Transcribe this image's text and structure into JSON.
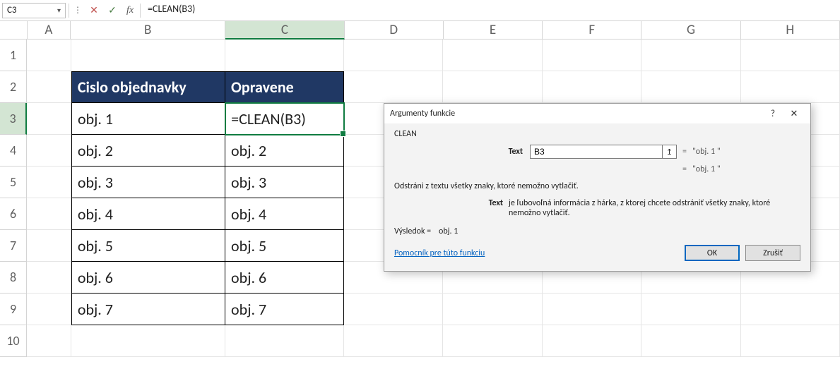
{
  "formula_bar": {
    "name_box": "C3",
    "cancel_glyph": "✕",
    "enter_glyph": "✓",
    "fx_label": "fx",
    "formula": "=CLEAN(B3)"
  },
  "columns": [
    "A",
    "B",
    "C",
    "D",
    "E",
    "F",
    "G",
    "H"
  ],
  "rows": [
    1,
    2,
    3,
    4,
    5,
    6,
    7,
    8,
    9,
    10
  ],
  "active": {
    "col": "C",
    "row": 3
  },
  "table": {
    "header_b": "Cislo objednavky",
    "header_c": "Opravene",
    "data": [
      {
        "b": "obj. 1",
        "c": "=CLEAN(B3)"
      },
      {
        "b": "obj. 2",
        "c": "obj. 2"
      },
      {
        "b": "obj. 3",
        "c": "obj. 3"
      },
      {
        "b": "obj. 4",
        "c": "obj. 4"
      },
      {
        "b": "obj. 5",
        "c": "obj. 5"
      },
      {
        "b": "obj. 6",
        "c": "obj. 6"
      },
      {
        "b": "obj. 7",
        "c": "obj. 7"
      }
    ]
  },
  "dialog": {
    "title": "Argumenty funkcie",
    "help_glyph": "?",
    "close_glyph": "✕",
    "func_name": "CLEAN",
    "arg_label": "Text",
    "arg_value": "B3",
    "collapse_glyph": "↥",
    "arg_eval": "\"obj. 1   \"",
    "result_eval": "\"obj. 1   \"",
    "desc": "Odstráni z textu všetky znaky, ktoré nemožno vytlačiť.",
    "desc2_label": "Text",
    "desc2_text": "je ľubovoľná informácia z hárka, z ktorej chcete odstrániť všetky znaky, ktoré nemožno vytlačiť.",
    "result_label": "Výsledok =",
    "result_value": "obj. 1",
    "help_link": "Pomocník pre túto funkciu",
    "ok": "OK",
    "cancel": "Zrušiť"
  }
}
